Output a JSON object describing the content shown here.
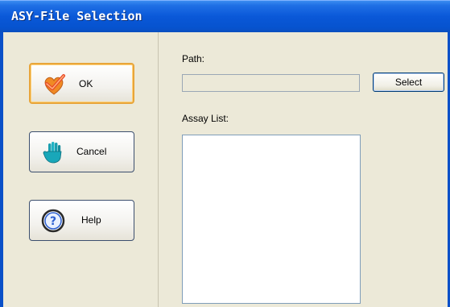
{
  "window": {
    "title": "ASY-File Selection"
  },
  "buttons": {
    "ok": {
      "label": "OK",
      "icon": "checkmark-heart-icon"
    },
    "cancel": {
      "label": "Cancel",
      "icon": "hand-stop-icon"
    },
    "help": {
      "label": "Help",
      "icon": "help-question-icon"
    }
  },
  "path": {
    "label": "Path:",
    "value": "",
    "select_label": "Select"
  },
  "assay": {
    "label": "Assay List:",
    "items": []
  },
  "colors": {
    "title_bar": "#0a58d8",
    "ok_focus": "#e8a53a",
    "background": "#ece9d8"
  }
}
